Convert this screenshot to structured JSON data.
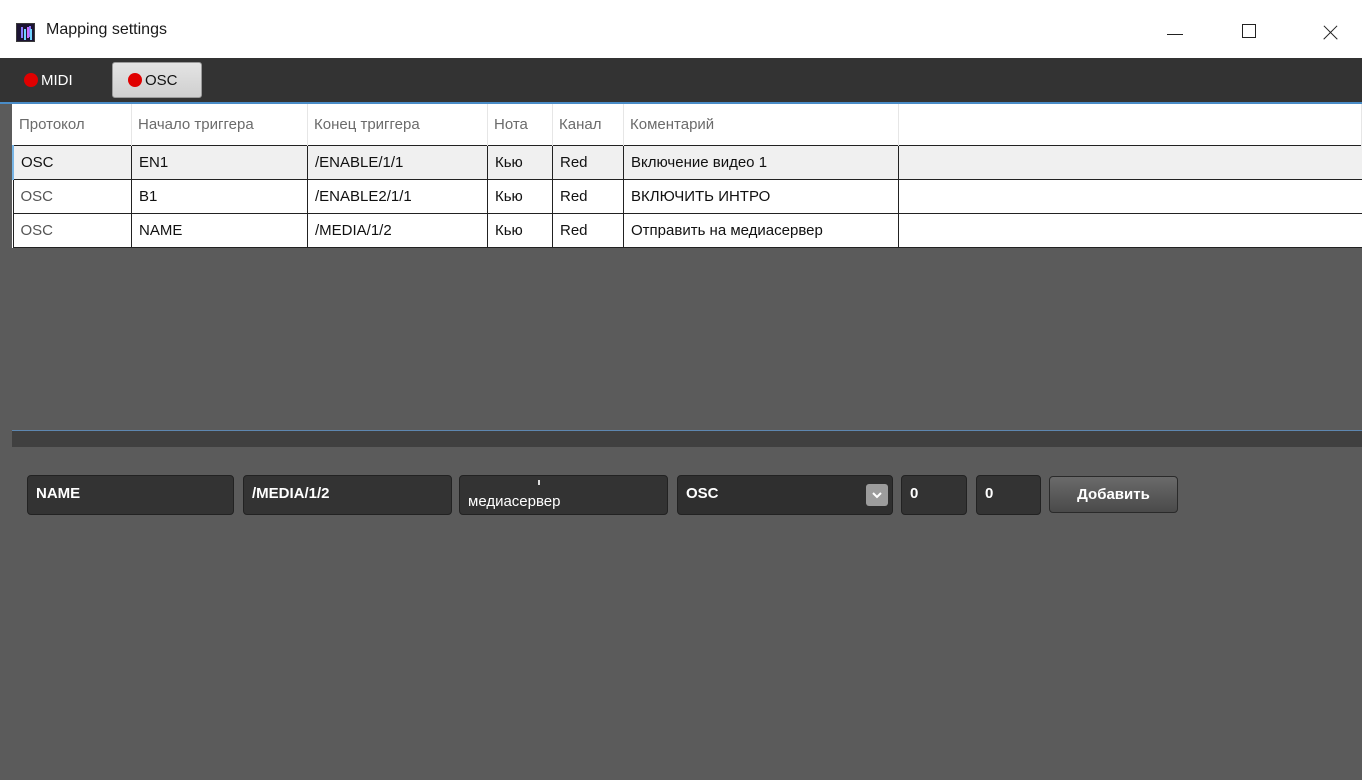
{
  "window": {
    "title": "Mapping settings",
    "controls": [
      "minimize",
      "maximize",
      "close"
    ]
  },
  "toolbar": {
    "buttons": [
      {
        "label": "MIDI",
        "status_color": "#e00000",
        "active": false
      },
      {
        "label": "OSC",
        "status_color": "#e00000",
        "active": true
      }
    ]
  },
  "table": {
    "columns": [
      "Протокол",
      "Начало триггера",
      "Конец триггера",
      "Нота",
      "Канал",
      "Коментарий"
    ],
    "rows": [
      {
        "protocol": "OSC",
        "start": "EN1",
        "end": "/ENABLE/1/1",
        "note": "Кью",
        "channel": "Red",
        "comment": "Включение видео 1",
        "selected": true
      },
      {
        "protocol": "OSC",
        "start": "B1",
        "end": "/ENABLE2/1/1",
        "note": "Кью",
        "channel": "Red",
        "comment": "ВКЛЮЧИТЬ ИНТРО",
        "selected": false
      },
      {
        "protocol": "OSC",
        "start": "NAME",
        "end": "/MEDIA/1/2",
        "note": "Кью",
        "channel": "Red",
        "comment": "Отправить на медиасервер",
        "selected": false
      }
    ]
  },
  "form": {
    "start_value": "NAME",
    "end_value": "/MEDIA/1/2",
    "comment_value": "медиасервер",
    "protocol_selected": "OSC",
    "note_value": "0",
    "channel_value": "0",
    "add_label": "Добавить"
  },
  "icons": {
    "app": "app-logo-icon",
    "status": "red-dot-icon",
    "dropdown": "chevron-down-icon"
  },
  "colors": {
    "background": "#5b5b5b",
    "toolbar": "#333333",
    "accent": "#4a8cc7",
    "status_red": "#e00000"
  }
}
